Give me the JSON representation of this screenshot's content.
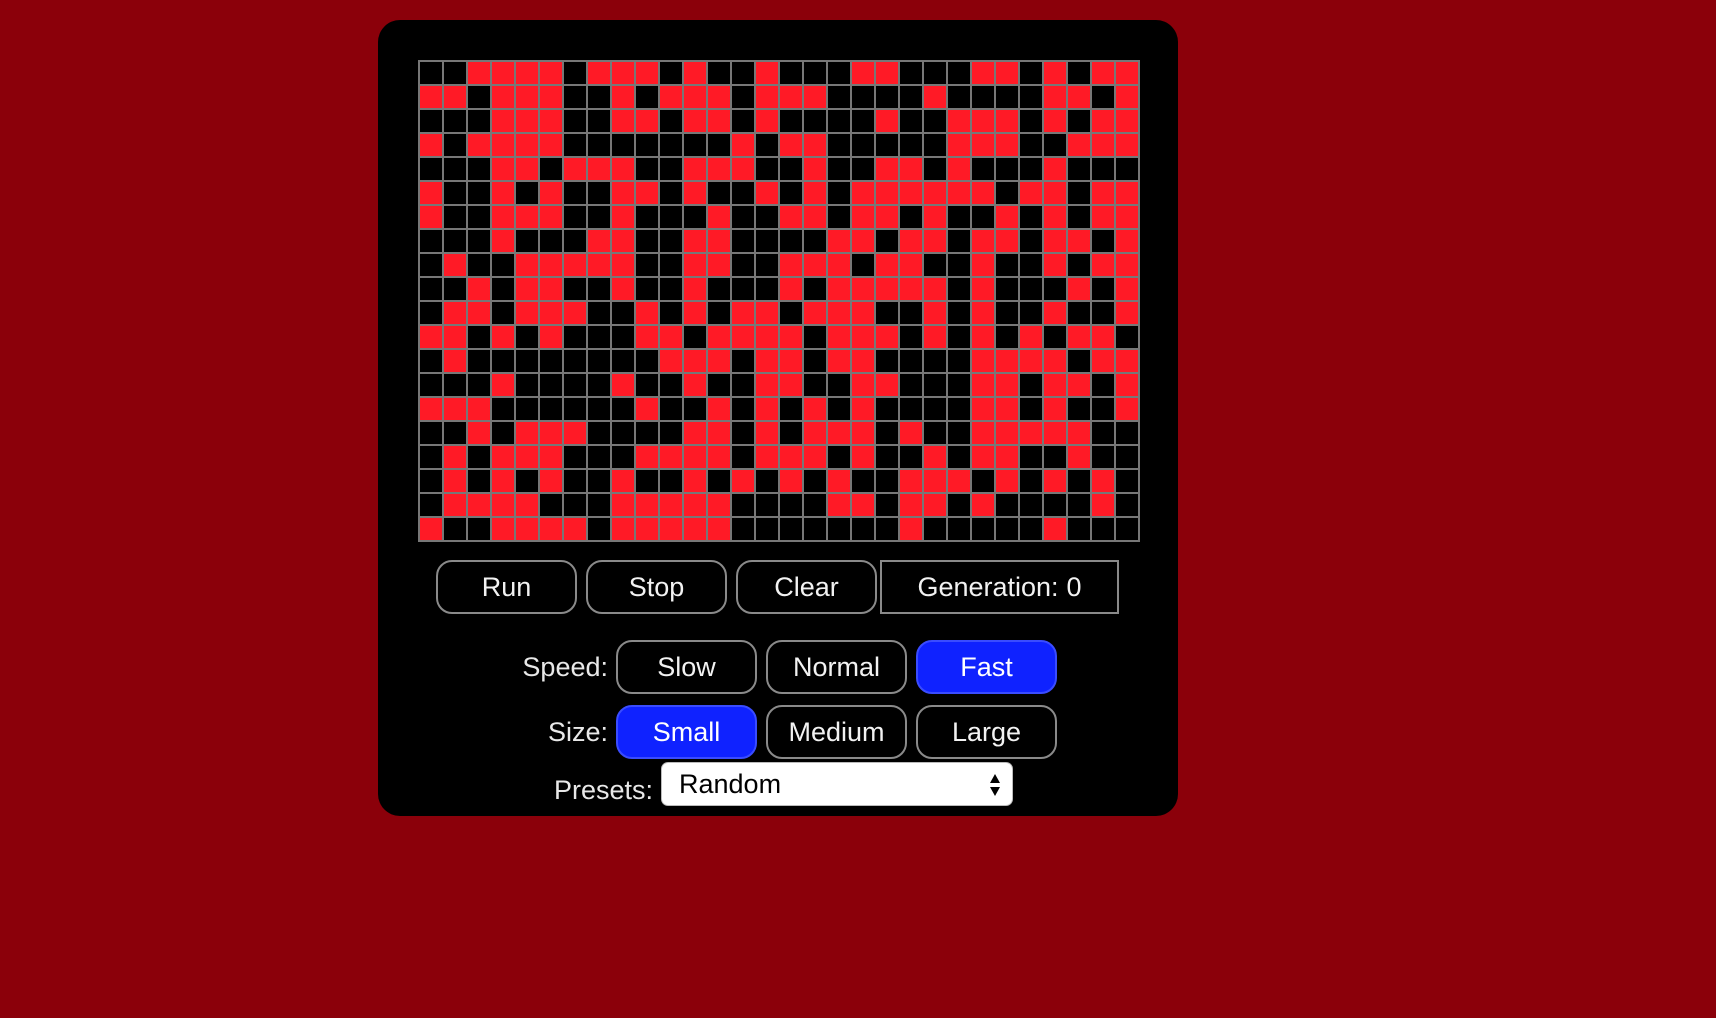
{
  "controls": {
    "run_label": "Run",
    "stop_label": "Stop",
    "clear_label": "Clear",
    "generation_label": "Generation:",
    "generation_value": "0"
  },
  "speed": {
    "label": "Speed:",
    "options": [
      "Slow",
      "Normal",
      "Fast"
    ],
    "selected": "Fast"
  },
  "size": {
    "label": "Size:",
    "options": [
      "Small",
      "Medium",
      "Large"
    ],
    "selected": "Small"
  },
  "presets": {
    "label": "Presets:",
    "selected": "Random"
  },
  "board": {
    "columns": 30,
    "rows": 20,
    "alive_color": "#ff1a26",
    "dead_color": "#000000",
    "cells": [
      "001111011101001000110001101011",
      "110111001011101110000100001101",
      "000111001101101000010011101011",
      "101111000000010110000011100111",
      "000110111001110010011010001000",
      "100101001101001010111111011011",
      "100111001000100110110100101011",
      "000100011001100001101101101101",
      "010011111001100111011001001011",
      "001011001001000101111101000101",
      "011011100101011011100101001001",
      "110101000110111101110101010110",
      "010000000011101101100001111011",
      "000100001001001100110001101101",
      "111000000100101010100001101001",
      "001011100001101011101001111100",
      "010111000111101110100101100100",
      "010101001001010101001110101010",
      "011110001111100001101101000010",
      "100111101111100000001000001000"
    ]
  }
}
